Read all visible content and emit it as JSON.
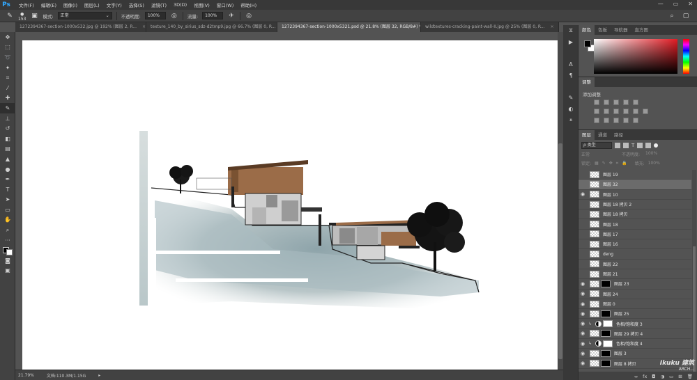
{
  "app": {
    "logo": "Ps"
  },
  "menu": [
    "文件(F)",
    "编辑(E)",
    "图像(I)",
    "图层(L)",
    "文字(Y)",
    "选择(S)",
    "滤镜(T)",
    "3D(D)",
    "视图(V)",
    "窗口(W)",
    "帮助(H)"
  ],
  "window_controls": {
    "minimize": "—",
    "maximize": "▭",
    "close": "✕"
  },
  "options": {
    "brush_size": "153",
    "mode_label": "模式:",
    "mode_value": "正常",
    "opacity_label": "不透明度:",
    "opacity_value": "100%",
    "flow_label": "流量:",
    "flow_value": "100%"
  },
  "tabs": [
    {
      "label": "1272394367-section-1000x532.jpg @ 192% (图层 2, R...",
      "close": "×",
      "active": false
    },
    {
      "label": "texture_140_by_sirius_sdz-d2tmp9.jpg @ 66.7% (图层 0, R...",
      "close": "×",
      "active": false
    },
    {
      "label": "1272394367-section-1000x5321.psd @ 21.8% (图层 32, RGB/8#) *",
      "close": "×",
      "active": true
    },
    {
      "label": "wildtextures-cracking-paint-wall-II.jpg @ 25% (图层 0, R...",
      "close": "×",
      "active": false
    }
  ],
  "status": {
    "zoom": "21.79%",
    "doc_label": "文档:110.3M/1.15G"
  },
  "color_panel": {
    "tabs": [
      "颜色",
      "色板",
      "导航器",
      "直方图"
    ],
    "fg": "#000000",
    "bg": "#ffffff"
  },
  "adjust_panel": {
    "tab": "调整",
    "title": "添加调整"
  },
  "layers_panel": {
    "tabs": [
      "图层",
      "通道",
      "路径"
    ],
    "filter_label": "ρ 类型",
    "blend_mode": "正常",
    "opacity_label": "不透明度:",
    "opacity_value": "100%",
    "lock_label": "锁定:",
    "fill_label": "填充:",
    "fill_value": "100%",
    "layers": [
      {
        "name": "图层 19",
        "visible": false,
        "selected": false,
        "kind": "pixel"
      },
      {
        "name": "图层 32",
        "visible": false,
        "selected": true,
        "kind": "pixel"
      },
      {
        "name": "图层 10",
        "visible": true,
        "selected": false,
        "kind": "pixel"
      },
      {
        "name": "图层 18 拷贝 2",
        "visible": false,
        "selected": false,
        "kind": "pixel"
      },
      {
        "name": "图层 18 拷贝",
        "visible": false,
        "selected": false,
        "kind": "pixel"
      },
      {
        "name": "图层 18",
        "visible": false,
        "selected": false,
        "kind": "pixel"
      },
      {
        "name": "图层 17",
        "visible": false,
        "selected": false,
        "kind": "pixel"
      },
      {
        "name": "图层 16",
        "visible": false,
        "selected": false,
        "kind": "pixel"
      },
      {
        "name": "deng",
        "visible": false,
        "selected": false,
        "kind": "pixel"
      },
      {
        "name": "图层 22",
        "visible": false,
        "selected": false,
        "kind": "pixel"
      },
      {
        "name": "图层 21",
        "visible": false,
        "selected": false,
        "kind": "pixel"
      },
      {
        "name": "图层 23",
        "visible": true,
        "selected": false,
        "kind": "mask-black"
      },
      {
        "name": "图层 24",
        "visible": true,
        "selected": false,
        "kind": "pixel"
      },
      {
        "name": "图层 0",
        "visible": true,
        "selected": false,
        "kind": "pixel"
      },
      {
        "name": "图层 25",
        "visible": true,
        "selected": false,
        "kind": "mask-black"
      },
      {
        "name": "色相/饱和度 3",
        "visible": true,
        "selected": false,
        "kind": "adjust"
      },
      {
        "name": "图层 29 拷贝 4",
        "visible": true,
        "selected": false,
        "kind": "mask-black"
      },
      {
        "name": "色相/饱和度 4",
        "visible": true,
        "selected": false,
        "kind": "adjust"
      },
      {
        "name": "图层 3",
        "visible": true,
        "selected": false,
        "kind": "mask-black"
      },
      {
        "name": "图层 8 拷贝",
        "visible": true,
        "selected": false,
        "kind": "mask-black"
      }
    ]
  },
  "watermark": {
    "text": "Ikuku 建筑",
    "sub": "ARCH..."
  }
}
